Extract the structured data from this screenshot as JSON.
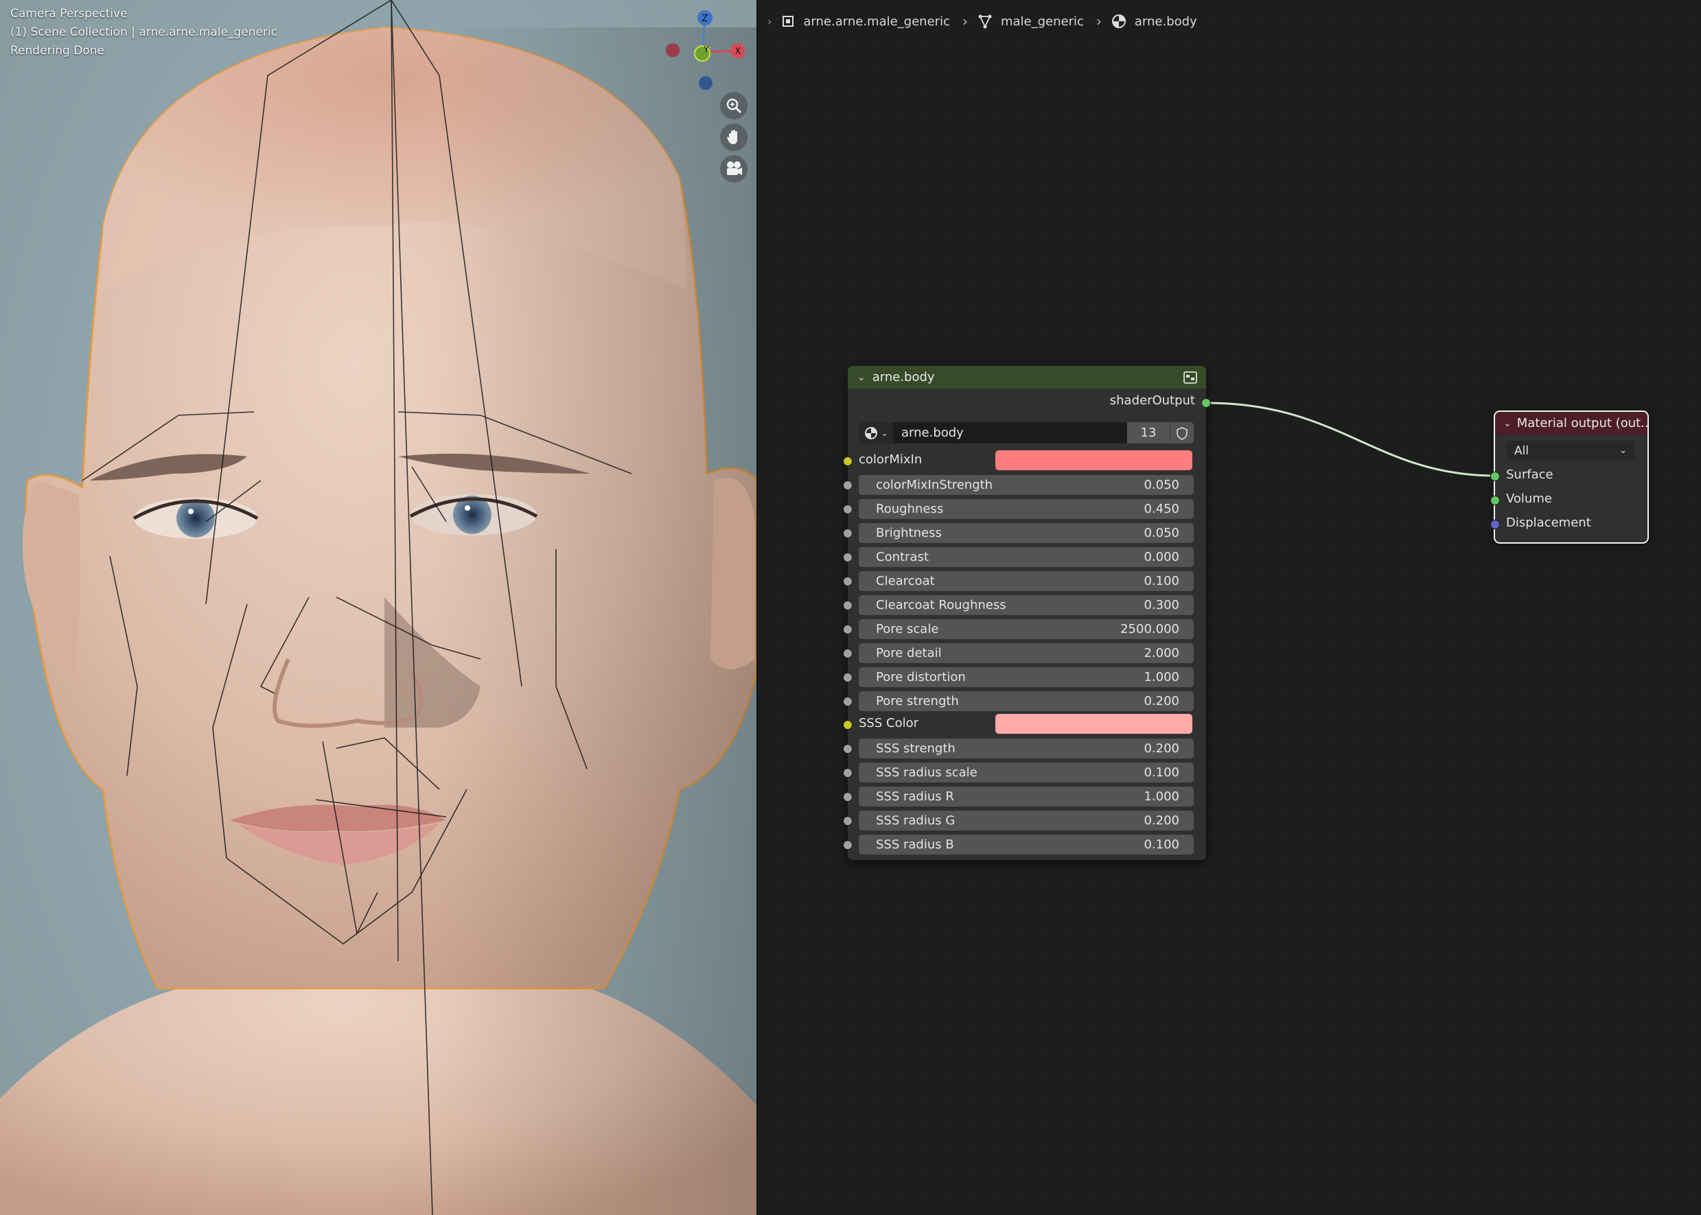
{
  "viewport": {
    "info_lines": [
      "Camera Perspective",
      "(1) Scene Collection | arne.arne.male_generic",
      "Rendering Done"
    ],
    "gizmo_axes": [
      "Z",
      "Y",
      "X"
    ],
    "nav_icons": [
      "zoom-icon",
      "hand-pan-icon",
      "camera-view-icon"
    ]
  },
  "breadcrumb": {
    "items": [
      {
        "label": "arne.arne.male_generic",
        "icon": "object-icon"
      },
      {
        "label": "male_generic",
        "icon": "mesh-data-icon"
      },
      {
        "label": "arne.body",
        "icon": "material-icon"
      }
    ]
  },
  "group_node": {
    "title": "arne.body",
    "header_color": "#384b28",
    "output_label": "shaderOutput",
    "datablock_name": "arne.body",
    "user_count": "13",
    "color_inputs": [
      {
        "label": "colorMixIn",
        "color": "#ff7d7d"
      },
      {
        "label": "SSS Color",
        "color": "#ffa9a9"
      }
    ],
    "properties": [
      {
        "label": "colorMixInStrength",
        "value": "0.050"
      },
      {
        "label": "Roughness",
        "value": "0.450"
      },
      {
        "label": "Brightness",
        "value": "0.050"
      },
      {
        "label": "Contrast",
        "value": "0.000"
      },
      {
        "label": "Clearcoat",
        "value": "0.100"
      },
      {
        "label": "Clearcoat Roughness",
        "value": "0.300"
      },
      {
        "label": "Pore scale",
        "value": "2500.000"
      },
      {
        "label": "Pore detail",
        "value": "2.000"
      },
      {
        "label": "Pore distortion",
        "value": "1.000"
      },
      {
        "label": "Pore strength",
        "value": "0.200"
      },
      {
        "label": "SSS strength",
        "value": "0.200"
      },
      {
        "label": "SSS radius scale",
        "value": "0.100"
      },
      {
        "label": "SSS radius R",
        "value": "1.000"
      },
      {
        "label": "SSS radius G",
        "value": "0.200"
      },
      {
        "label": "SSS radius B",
        "value": "0.100"
      }
    ]
  },
  "output_node": {
    "title": "Material output (out...",
    "header_color": "#4d1e27",
    "target": "All",
    "inputs": [
      "Surface",
      "Volume",
      "Displacement"
    ]
  },
  "colors": {
    "editor_bg": "#1d1d1d",
    "link_color": "#cfe8c9",
    "selection_outline": "#e99a3b"
  }
}
